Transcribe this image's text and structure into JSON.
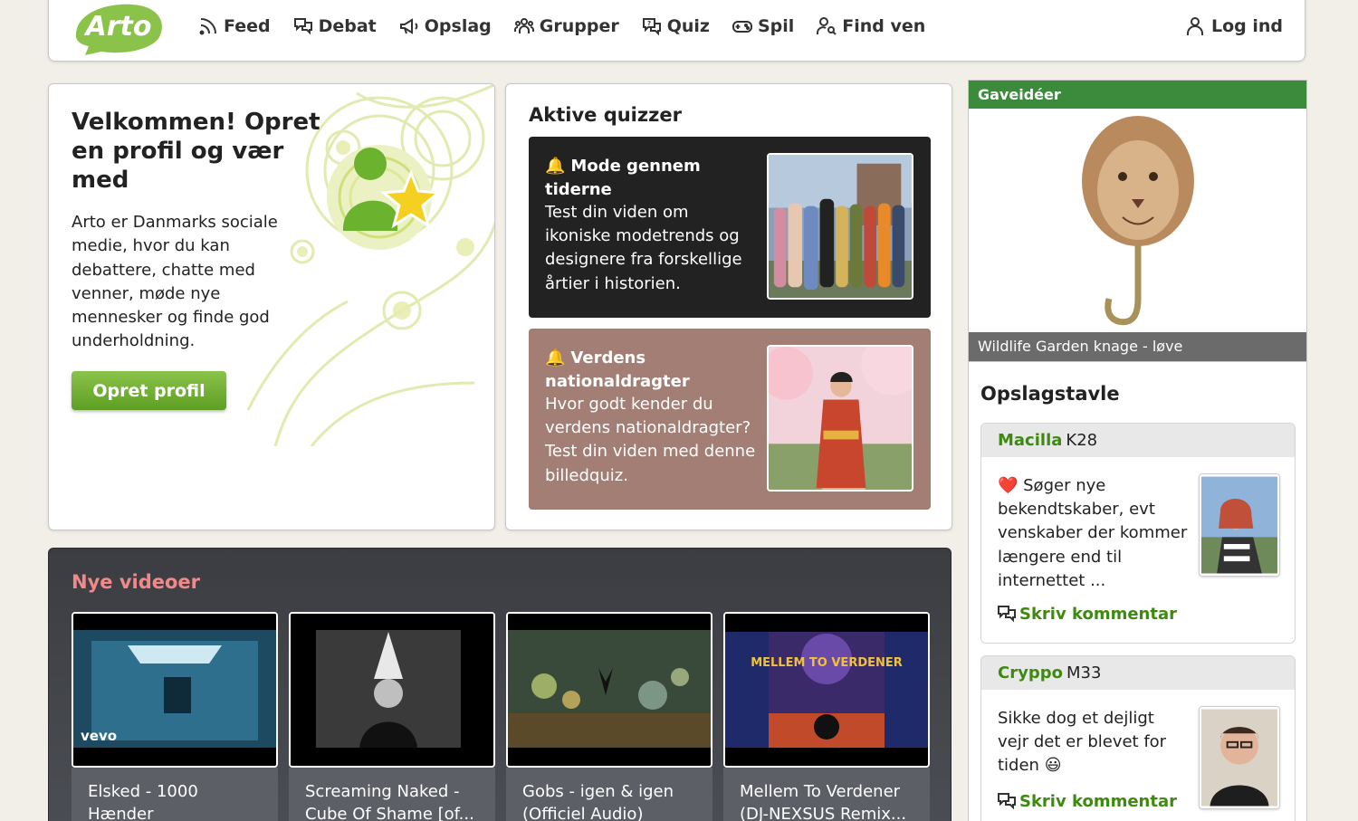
{
  "brand": {
    "logo_text": "Arto",
    "green": "#8bc34a",
    "link_green": "#3e8a11"
  },
  "nav": {
    "items": [
      {
        "label": "Feed",
        "icon": "rss-icon"
      },
      {
        "label": "Debat",
        "icon": "chat-bubbles-icon"
      },
      {
        "label": "Opslag",
        "icon": "megaphone-icon"
      },
      {
        "label": "Grupper",
        "icon": "group-icon"
      },
      {
        "label": "Quiz",
        "icon": "quiz-icon"
      },
      {
        "label": "Spil",
        "icon": "gamepad-icon"
      },
      {
        "label": "Find ven",
        "icon": "find-user-icon"
      }
    ],
    "login_label": "Log ind"
  },
  "welcome": {
    "title": "Velkommen! Opret en profil og vær med",
    "body": "Arto er Danmarks sociale medie, hvor du kan debattere, chatte med venner, møde nye mennesker og finde god underholdning.",
    "button": "Opret profil"
  },
  "quizzes": {
    "heading": "Aktive quizzer",
    "items": [
      {
        "title": "Mode gennem tiderne",
        "description": "Test din viden om ikoniske modetrends og designere fra forskellige årtier i historien."
      },
      {
        "title": "Verdens nationaldragter",
        "description": "Hvor godt kender du verdens nationaldragter? Test din viden med denne billedquiz."
      }
    ]
  },
  "gift": {
    "header": "Gaveidéer",
    "caption": "Wildlife Garden knage - løve"
  },
  "board": {
    "heading": "Opslagstavle",
    "posts": [
      {
        "user": "Macilla",
        "meta": "K28",
        "text": "❤️ Søger nye bekendtskaber, evt venskaber der kommer længere end til internettet ...",
        "comment": "Skriv kommentar"
      },
      {
        "user": "Cryppo",
        "meta": "M33",
        "text": "Sikke dog et dejligt vejr det er blevet for tiden 😃",
        "comment": "Skriv kommentar"
      }
    ]
  },
  "videos": {
    "heading": "Nye videoer",
    "items": [
      {
        "title": "Elsked - 1000 Hænder",
        "badge": "vevo"
      },
      {
        "title": "Screaming Naked - Cube Of Shame [of...",
        "badge": ""
      },
      {
        "title": "Gobs - igen & igen (Officiel Audio)",
        "badge": ""
      },
      {
        "title": "Mellem To Verdener (DJ-NEXSUS Remix...",
        "badge": ""
      }
    ],
    "thumb3_overlay": "MELLEM TO VERDENER"
  }
}
